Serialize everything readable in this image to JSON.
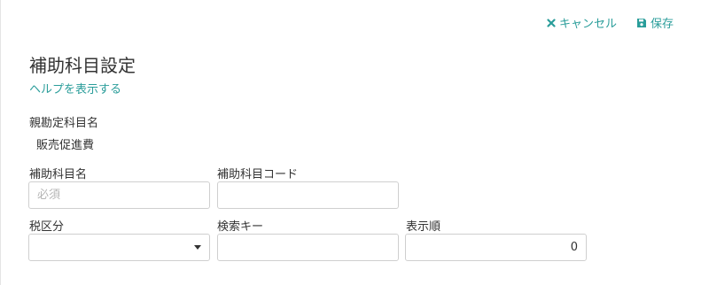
{
  "toolbar": {
    "cancel_label": "キャンセル",
    "save_label": "保存",
    "cancel_icon": "close-icon",
    "save_icon": "floppy-disk-icon"
  },
  "page": {
    "title": "補助科目設定",
    "help_link": "ヘルプを表示する"
  },
  "parent_account": {
    "label": "親勘定科目名",
    "value": "販売促進費"
  },
  "form": {
    "sub_account_name": {
      "label": "補助科目名",
      "value": "",
      "placeholder": "必須"
    },
    "sub_account_code": {
      "label": "補助科目コード",
      "value": ""
    },
    "tax_category": {
      "label": "税区分",
      "selected": ""
    },
    "search_key": {
      "label": "検索キー",
      "value": ""
    },
    "display_order": {
      "label": "表示順",
      "value": "0"
    }
  },
  "colors": {
    "accent": "#2a9d9a",
    "text": "#333333",
    "border": "#cfcfcf",
    "placeholder": "#b5b5b5"
  }
}
